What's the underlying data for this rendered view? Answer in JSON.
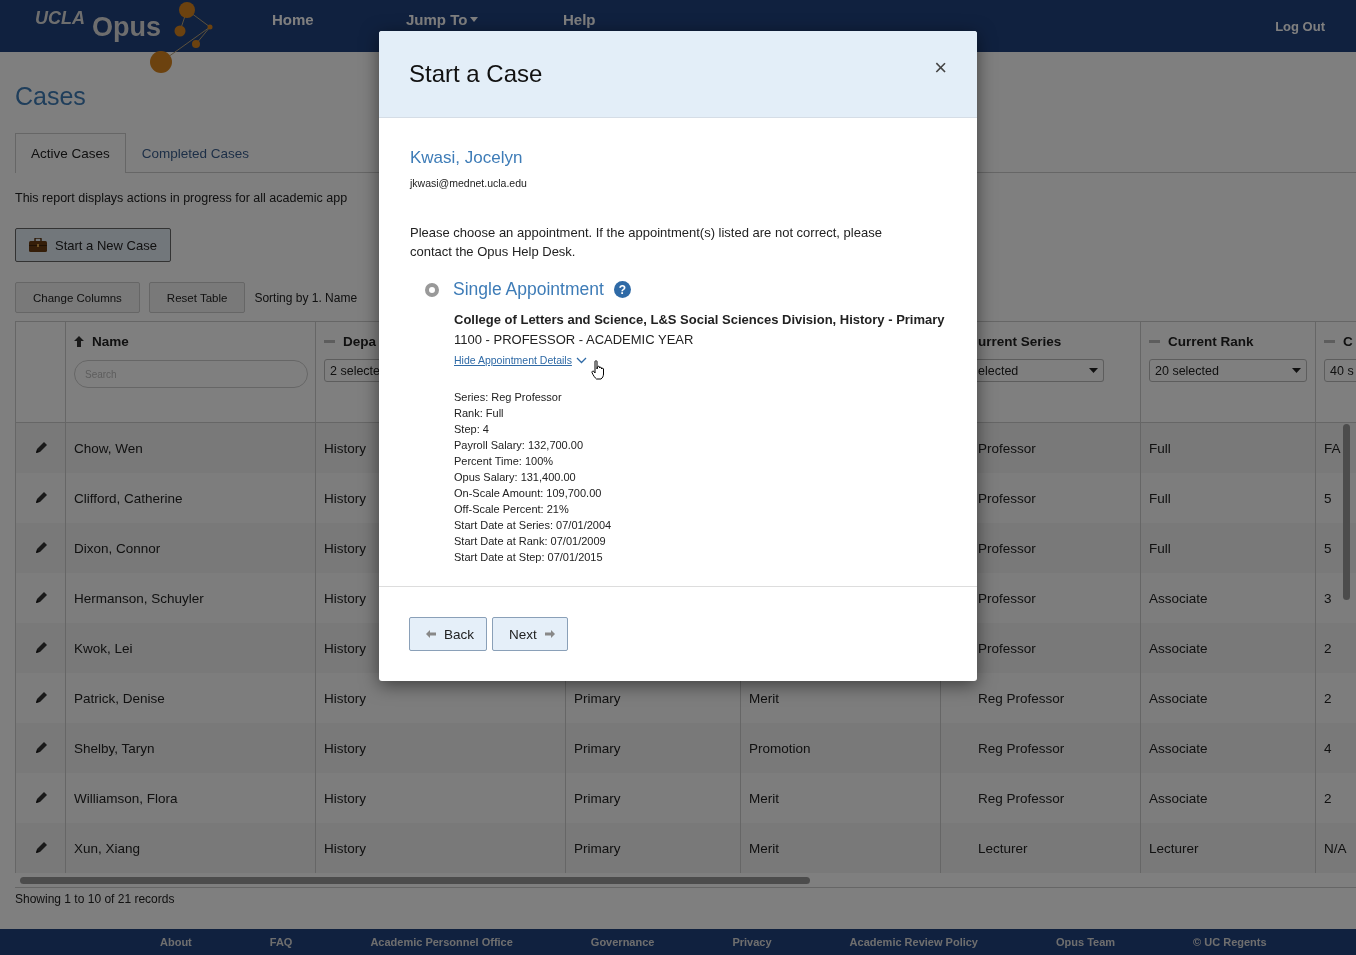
{
  "nav": {
    "logo": {
      "org": "UCLA",
      "app": "Opus"
    },
    "items": [
      {
        "label": "Home",
        "dropdown": false
      },
      {
        "label": "Jump To",
        "dropdown": true
      },
      {
        "label": "Help",
        "dropdown": false
      }
    ],
    "log_out": "Log Out"
  },
  "page_title": "Cases",
  "tabs": [
    {
      "label": "Active Cases",
      "selected": true
    },
    {
      "label": "Completed Cases",
      "selected": false
    }
  ],
  "description": "This report displays actions in progress for all academic app",
  "start_button": "Start a New Case",
  "toolbar": {
    "buttons": [
      "Change Columns",
      "Reset Table"
    ],
    "sorting": "Sorting by 1. Name"
  },
  "table": {
    "columns": [
      {
        "label": "Name",
        "sorted": true,
        "filter": {
          "kind": "search",
          "placeholder": "Search"
        }
      },
      {
        "label": "Depa",
        "sorted": false,
        "filter": {
          "kind": "select",
          "value": "2 selecte"
        }
      },
      null,
      null,
      {
        "label": "urrent Series",
        "cut_left": true,
        "filter": {
          "kind": "select",
          "value": "elected"
        }
      },
      {
        "label": "Current Rank",
        "sorted": false,
        "filter": {
          "kind": "select",
          "value": "20 selected"
        }
      },
      {
        "label": "C",
        "sorted": false,
        "filter": {
          "kind": "select",
          "value": "40 s"
        }
      }
    ],
    "rows": [
      {
        "cells": [
          "Chow, Wen",
          "History",
          null,
          null,
          "Professor",
          "Full",
          "FA"
        ]
      },
      {
        "cells": [
          "Clifford, Catherine",
          "History",
          null,
          null,
          "Professor",
          "Full",
          "5"
        ]
      },
      {
        "cells": [
          "Dixon, Connor",
          "History",
          null,
          null,
          "Professor",
          "Full",
          "5"
        ]
      },
      {
        "cells": [
          "Hermanson, Schuyler",
          "History",
          null,
          null,
          "Professor",
          "Associate",
          "3"
        ]
      },
      {
        "cells": [
          "Kwok, Lei",
          "History",
          null,
          null,
          "Professor",
          "Associate",
          "2"
        ]
      },
      {
        "cells": [
          "Patrick, Denise",
          "History",
          "Primary",
          "Merit",
          "Reg Professor",
          "Associate",
          "2"
        ]
      },
      {
        "cells": [
          "Shelby, Taryn",
          "History",
          "Primary",
          "Promotion",
          "Reg Professor",
          "Associate",
          "4"
        ]
      },
      {
        "cells": [
          "Williamson, Flora",
          "History",
          "Primary",
          "Merit",
          "Reg Professor",
          "Associate",
          "2"
        ]
      },
      {
        "cells": [
          "Xun, Xiang",
          "History",
          "Primary",
          "Merit",
          "Lecturer",
          "Lecturer",
          "N/A"
        ]
      }
    ]
  },
  "records": "Showing 1 to 10 of 21 records",
  "footer": [
    "About",
    "FAQ",
    "Academic Personnel Office",
    "Governance",
    "Privacy",
    "Academic Review Policy",
    "Opus Team",
    "© UC Regents"
  ],
  "modal": {
    "title": "Start a Case",
    "close": "×",
    "person": {
      "name": "Kwasi, Jocelyn",
      "email": "jkwasi@mednet.ucla.edu"
    },
    "instructions": "Please choose an appointment. If the appointment(s) listed are not correct, please contact the Opus Help Desk.",
    "options": [
      {
        "label": "Single Appointment",
        "help": "?",
        "selected": true,
        "unit": "College of Letters and Science, L&S Social Sciences Division, History - Primary",
        "title": "1100 - PROFESSOR - ACADEMIC YEAR",
        "details_link": "Hide Appointment Details",
        "expanded": true,
        "details": [
          "Series: Reg Professor",
          "Rank: Full",
          "Step: 4",
          "Payroll Salary: 132,700.00",
          "Percent Time: 100%",
          "Opus Salary: 131,400.00",
          "On-Scale Amount: 109,700.00",
          "Off-Scale Percent: 21%",
          "Start Date at Series: 07/01/2004",
          "Start Date at Rank: 07/01/2009",
          "Start Date at Step: 07/01/2015"
        ]
      }
    ],
    "buttons": [
      {
        "label": "Back",
        "kind": "back"
      },
      {
        "label": "Next",
        "kind": "next"
      }
    ]
  }
}
